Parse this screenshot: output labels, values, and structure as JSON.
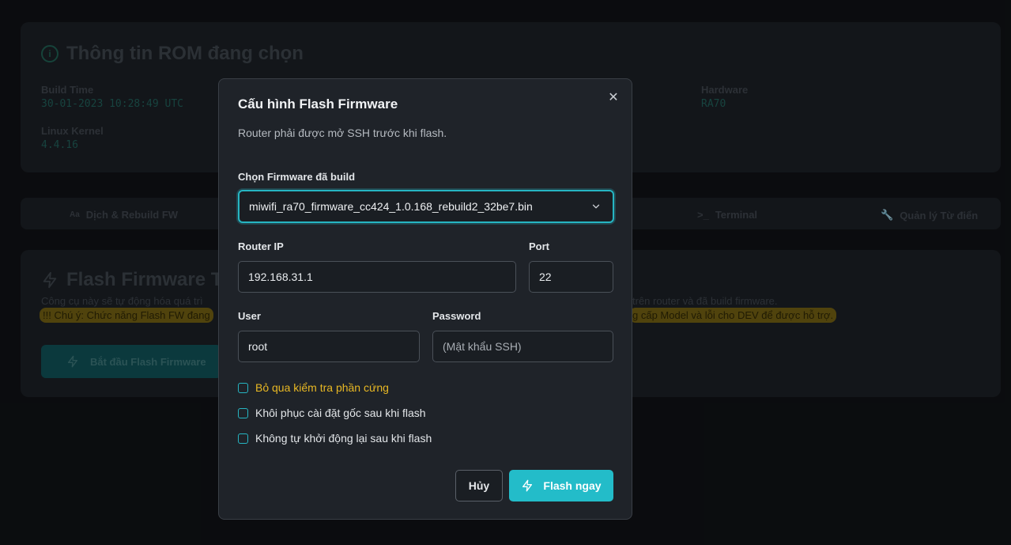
{
  "background": {
    "rom_title": "Thông tin ROM đang chọn",
    "build_time_label": "Build Time",
    "build_time_value": "30-01-2023 10:28:49 UTC",
    "hardware_label": "Hardware",
    "hardware_value": "RA70",
    "kernel_label": "Linux Kernel",
    "kernel_value": "4.4.16",
    "tabs": {
      "translate": "Dịch & Rebuild FW",
      "terminal": "Terminal",
      "dictionary": "Quản lý Từ điển"
    },
    "flash_title": "Flash Firmware To",
    "flash_desc_left": "Công cụ này sẽ tự động hóa quá trì",
    "flash_desc_right": "trên router và đã build firmware.",
    "flash_warn_left": "!!! Chú ý: Chức năng Flash FW đang",
    "flash_warn_right": "g cấp Model và lỗi cho DEV để được hỗ trợ.",
    "start_button": "Bắt đầu Flash Firmware"
  },
  "modal": {
    "title": "Cấu hình Flash Firmware",
    "subtitle": "Router phải được mở SSH trước khi flash.",
    "firmware_label": "Chọn Firmware đã build",
    "firmware_selected": "miwifi_ra70_firmware_cc424_1.0.168_rebuild2_32be7.bin",
    "router_ip_label": "Router IP",
    "router_ip_value": "192.168.31.1",
    "port_label": "Port",
    "port_value": "22",
    "user_label": "User",
    "user_value": "root",
    "password_label": "Password",
    "password_placeholder": "(Mật khẩu SSH)",
    "options": [
      "Bỏ qua kiểm tra phần cứng",
      "Khôi phục cài đặt gốc sau khi flash",
      "Không tự khởi động lại sau khi flash"
    ],
    "cancel_label": "Hủy",
    "flash_label": "Flash ngay"
  },
  "colors": {
    "accent": "#23bcc9",
    "warning": "#e8b824"
  }
}
